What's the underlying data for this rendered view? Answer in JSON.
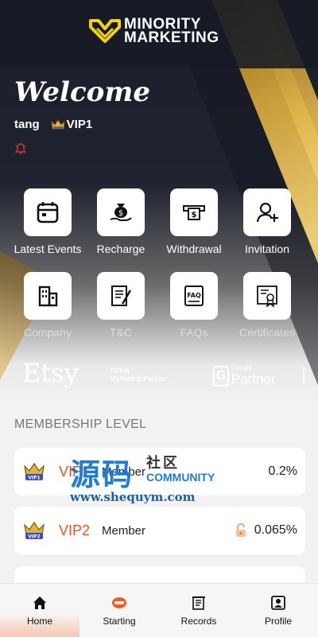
{
  "header": {
    "logo_line1": "MINORITY",
    "logo_line2": "MARKETING"
  },
  "greeting": "Welcome",
  "user": {
    "name": "tang",
    "vip": "VIP1"
  },
  "menu": [
    {
      "label": "Latest Events",
      "icon": "calendar-icon"
    },
    {
      "label": "Recharge",
      "icon": "money-bag-icon"
    },
    {
      "label": "Withdrawal",
      "icon": "cash-withdraw-icon"
    },
    {
      "label": "Invitation",
      "icon": "add-user-icon"
    },
    {
      "label": "Company",
      "icon": "building-icon"
    },
    {
      "label": "T&C",
      "icon": "document-pen-icon"
    },
    {
      "label": "FAQs",
      "icon": "faq-icon"
    },
    {
      "label": "Certificates",
      "icon": "certificate-icon"
    }
  ],
  "partners": {
    "etsy": "Etsy",
    "tiktok_line1": "TikTok",
    "tiktok_line2": "Marketing Partner",
    "google_line1": "Google",
    "google_line2": "Partner"
  },
  "membership": {
    "title": "MEMBERSHIP LEVEL",
    "levels": [
      {
        "name": "VIP1",
        "member": "Member",
        "rate": "0.2%"
      },
      {
        "name": "VIP2",
        "member": "Member",
        "rate": "0.065%"
      }
    ]
  },
  "watermark": {
    "big": "源码",
    "side": "社区",
    "community": "COMMUNITY",
    "url": "www.shequym.com"
  },
  "tabs": [
    {
      "label": "Home",
      "icon": "home-icon"
    },
    {
      "label": "Starting",
      "icon": "starting-icon"
    },
    {
      "label": "Records",
      "icon": "records-icon"
    },
    {
      "label": "Profile",
      "icon": "profile-icon"
    }
  ],
  "colors": {
    "accent": "#e8531c",
    "gold": "#d9ab45",
    "dark": "#1b1f2b"
  }
}
